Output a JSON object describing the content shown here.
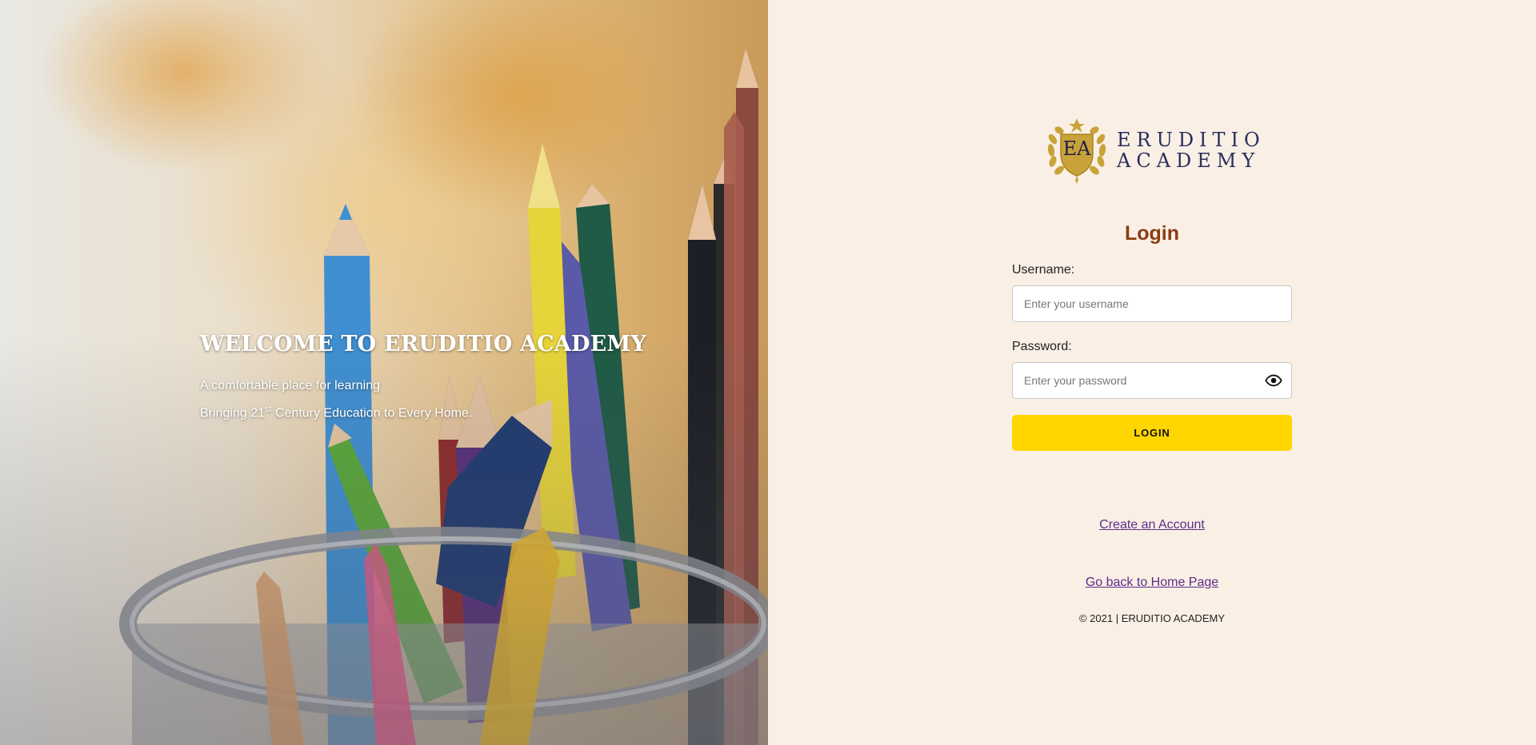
{
  "hero": {
    "title": "WELCOME TO ERUDITIO ACADEMY",
    "line1": "A comfortable place for learning",
    "line2_before": "Bringing 21",
    "line2_sup": "st",
    "line2_after": " Century Education to Every Home."
  },
  "logo": {
    "initials": "EA",
    "word1": "ERUDITIO",
    "word2": "ACADEMY"
  },
  "login": {
    "title": "Login",
    "username_label": "Username:",
    "username_placeholder": "Enter your username",
    "username_value": "",
    "password_label": "Password:",
    "password_placeholder": "Enter your password",
    "password_value": "",
    "show_password_icon": "eye-icon",
    "submit_label": "LOGIN"
  },
  "links": {
    "create_account": "Create an Account",
    "go_home": "Go back to Home Page"
  },
  "footer": {
    "copyright": "© 2021 | ERUDITIO ACADEMY"
  },
  "colors": {
    "panel_bg": "#f9efe5",
    "login_title": "#8b3d12",
    "button": "#ffd600",
    "link": "#5b2d8a",
    "logo_gold": "#c9a33a",
    "logo_navy": "#2a2f5b"
  }
}
